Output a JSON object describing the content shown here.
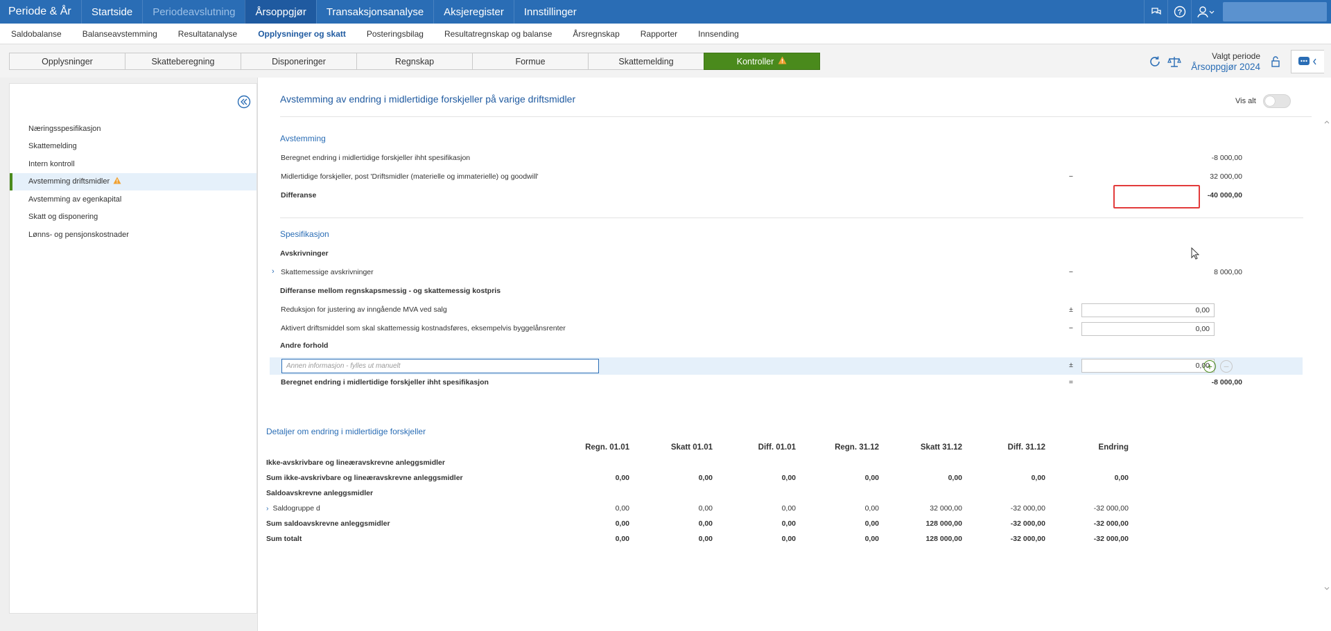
{
  "topbar": {
    "brand": "Periode & År",
    "items": [
      {
        "label": "Startside",
        "state": "normal"
      },
      {
        "label": "Periodeavslutning",
        "state": "dim"
      },
      {
        "label": "Årsoppgjør",
        "state": "active"
      },
      {
        "label": "Transaksjonsanalyse",
        "state": "normal"
      },
      {
        "label": "Aksjeregister",
        "state": "normal"
      },
      {
        "label": "Innstillinger",
        "state": "normal"
      }
    ]
  },
  "subnav": {
    "items": [
      {
        "label": "Saldobalanse"
      },
      {
        "label": "Balanseavstemming"
      },
      {
        "label": "Resultatanalyse"
      },
      {
        "label": "Opplysninger og skatt",
        "active": true
      },
      {
        "label": "Posteringsbilag"
      },
      {
        "label": "Resultatregnskap og balanse"
      },
      {
        "label": "Årsregnskap"
      },
      {
        "label": "Rapporter"
      },
      {
        "label": "Innsending"
      }
    ]
  },
  "tabs": [
    {
      "label": "Opplysninger"
    },
    {
      "label": "Skatteberegning"
    },
    {
      "label": "Disponeringer"
    },
    {
      "label": "Regnskap"
    },
    {
      "label": "Formue"
    },
    {
      "label": "Skattemelding"
    },
    {
      "label": "Kontroller",
      "active": true,
      "warning": true
    }
  ],
  "period": {
    "label": "Valgt periode",
    "value": "Årsoppgjør 2024"
  },
  "sidebar": {
    "items": [
      {
        "label": "Næringsspesifikasjon"
      },
      {
        "label": "Skattemelding"
      },
      {
        "label": "Intern kontroll"
      },
      {
        "label": "Avstemming driftsmidler",
        "active": true,
        "warning": true
      },
      {
        "label": "Avstemming av egenkapital"
      },
      {
        "label": "Skatt og disponering"
      },
      {
        "label": "Lønns- og pensjonskostnader"
      }
    ]
  },
  "main": {
    "title": "Avstemming av endring i midlertidige forskjeller på varige driftsmidler",
    "vis_alt": "Vis alt",
    "avstemming": {
      "heading": "Avstemming",
      "rows": [
        {
          "label": "Beregnet endring i midlertidige forskjeller ihht spesifikasjon",
          "op": "",
          "value": "-8 000,00"
        },
        {
          "label": "Midlertidige forskjeller, post 'Driftsmidler (materielle og immaterielle) og goodwill'",
          "op": "−",
          "value": "32 000,00"
        },
        {
          "label": "Differanse",
          "op": "",
          "value": "-40 000,00"
        }
      ]
    },
    "spesifikasjon": {
      "heading": "Spesifikasjon",
      "avskrivninger_heading": "Avskrivninger",
      "skattemessige": {
        "label": "Skattemessige avskrivninger",
        "op": "−",
        "value": "8 000,00"
      },
      "differanse_heading": "Differanse mellom regnskapsmessig - og skattemessig kostpris",
      "reduksjon": {
        "label": "Reduksjon for justering av inngående MVA ved salg",
        "op": "±",
        "value": "0,00"
      },
      "aktivert": {
        "label": "Aktivert driftsmiddel som skal skattemessig kostnadsføres, eksempelvis byggelånsrenter",
        "op": "−",
        "value": "0,00"
      },
      "andre_heading": "Andre forhold",
      "annen": {
        "placeholder": "Annen informasjon - fylles ut manuelt",
        "op": "±",
        "value": "0,00"
      },
      "total": {
        "label": "Beregnet endring i midlertidige forskjeller ihht spesifikasjon",
        "op": "=",
        "value": "-8 000,00"
      }
    },
    "details": {
      "title": "Detaljer om endring i midlertidige forskjeller",
      "columns": [
        "Regn. 01.01",
        "Skatt 01.01",
        "Diff. 01.01",
        "Regn. 31.12",
        "Skatt 31.12",
        "Diff. 31.12",
        "Endring"
      ],
      "rows": [
        {
          "label": "Ikke-avskrivbare og lineæravskrevne anleggsmidler",
          "kind": "group",
          "values": [
            "",
            "",
            "",
            "",
            "",
            "",
            ""
          ]
        },
        {
          "label": "Sum ikke-avskrivbare og lineæravskrevne anleggsmidler",
          "kind": "bold",
          "values": [
            "0,00",
            "0,00",
            "0,00",
            "0,00",
            "0,00",
            "0,00",
            "0,00"
          ]
        },
        {
          "label": "Saldoavskrevne anleggsmidler",
          "kind": "group",
          "values": [
            "",
            "",
            "",
            "",
            "",
            "",
            ""
          ]
        },
        {
          "label": "Saldogruppe d",
          "kind": "expand",
          "values": [
            "0,00",
            "0,00",
            "0,00",
            "0,00",
            "32 000,00",
            "-32 000,00",
            "-32 000,00"
          ]
        },
        {
          "label": "Sum saldoavskrevne anleggsmidler",
          "kind": "bold",
          "values": [
            "0,00",
            "0,00",
            "0,00",
            "0,00",
            "128 000,00",
            "-32 000,00",
            "-32 000,00"
          ]
        },
        {
          "label": "Sum totalt",
          "kind": "bold",
          "values": [
            "0,00",
            "0,00",
            "0,00",
            "0,00",
            "128 000,00",
            "-32 000,00",
            "-32 000,00"
          ]
        }
      ]
    }
  },
  "colors": {
    "primary": "#2a6db5",
    "active_tab": "#4a8a1c",
    "warning": "#f0a030",
    "highlight": "#e23a3a"
  }
}
